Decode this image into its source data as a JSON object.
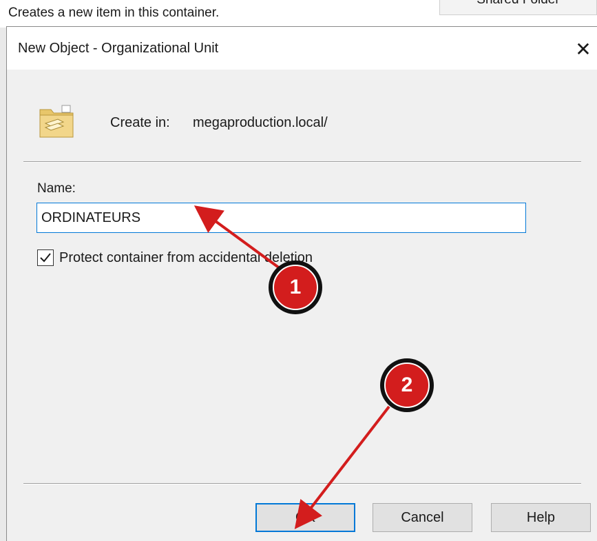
{
  "background": {
    "status_text": "Creates a new item in this container.",
    "shared_folder_label": "Shared Folder"
  },
  "dialog": {
    "title": "New Object - Organizational Unit",
    "close_symbol": "✕",
    "icon": "organizational-unit-folder-icon",
    "create_in_label": "Create in:",
    "create_in_value": "megaproduction.local/",
    "name_label": "Name:",
    "name_value": "ORDINATEURS",
    "protect_checkbox": {
      "label": "Protect container from accidental deletion",
      "checked": true
    },
    "buttons": {
      "ok": "OK",
      "cancel": "Cancel",
      "help": "Help"
    }
  },
  "annotations": {
    "step1": "1",
    "step2": "2",
    "color": "#d31d1d"
  },
  "colors": {
    "dialog_bg": "#f0f0f0",
    "accent": "#0078d7",
    "button_bg": "#e1e1e1"
  }
}
